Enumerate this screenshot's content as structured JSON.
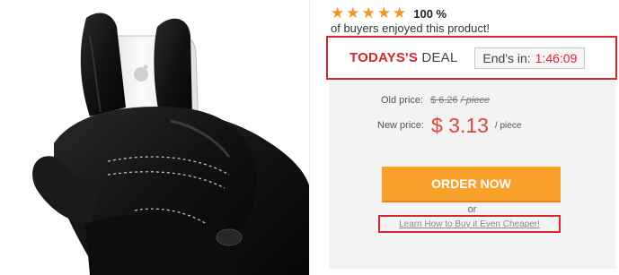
{
  "product": {
    "image_alt": "Black leather touchscreen gloves holding a white smartphone"
  },
  "rating": {
    "stars": 5,
    "percent": "100 %",
    "text": "of buyers enjoyed this product!"
  },
  "deal": {
    "title_strong": "TODAYS'S",
    "title_rest": "DEAL",
    "countdown_label": "End's in:",
    "countdown_time": "1:46:09"
  },
  "price": {
    "old_label": "Old price:",
    "old_value": "$ 6.26",
    "old_unit": "/ piece",
    "new_label": "New price:",
    "new_value": "$ 3.13",
    "new_unit": "/ piece"
  },
  "actions": {
    "order_label": "ORDER NOW",
    "or_text": "or",
    "cheaper_link": "Learn How to Buy it Even Cheaper!"
  },
  "colors": {
    "accent_red": "#d9262d",
    "order_orange": "#f9a12b",
    "star_orange": "#f7931e",
    "price_red": "#e0433f",
    "panel_gray": "#f3f3f3"
  }
}
